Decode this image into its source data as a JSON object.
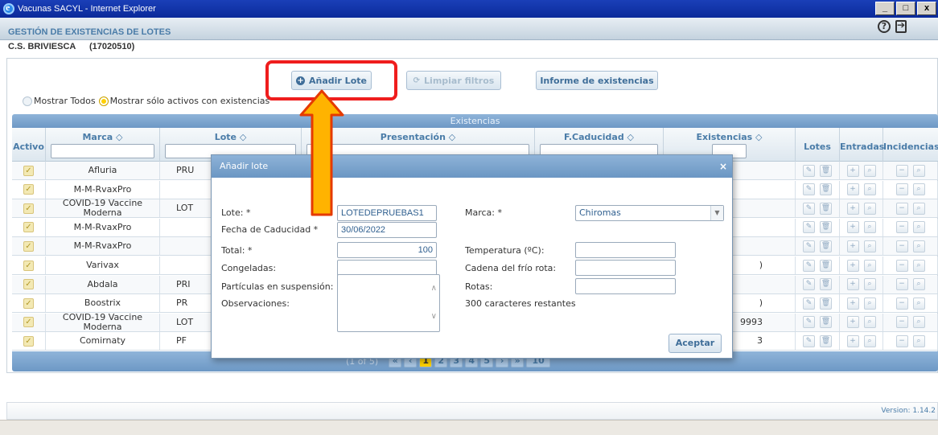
{
  "window": {
    "title": "Vacunas SACYL - Internet Explorer",
    "controls": {
      "minimize": "_",
      "maximize": "□",
      "close": "x"
    }
  },
  "app": {
    "title": "GESTIÓN DE EXISTENCIAS DE LOTES",
    "center_name": "C.S. BRIVIESCA",
    "center_code": "(17020510)",
    "help_glyph": "?"
  },
  "toolbar": {
    "add_lot": "Añadir Lote",
    "clear_filters": "Limpiar filtros",
    "stock_report": "Informe de existencias"
  },
  "filter_radios": {
    "show_all": "Mostrar Todos",
    "show_active": "Mostrar sólo activos con existencias",
    "selected": "show_active"
  },
  "grid": {
    "caption": "Existencias",
    "headers": {
      "activo": "Activo",
      "marca": "Marca ◇",
      "lote": "Lote ◇",
      "presentacion": "Presentación ◇",
      "caducidad": "F.Caducidad ◇",
      "existencias": "Existencias ◇",
      "lotes": "Lotes",
      "entradas": "Entradas",
      "incidencias": "Incidencias"
    },
    "rows": [
      {
        "marca": "Afluria",
        "lote": "PRU",
        "exist": ""
      },
      {
        "marca": "M-M-RvaxPro",
        "lote": "",
        "exist": ""
      },
      {
        "marca": "COVID-19 Vaccine Moderna",
        "lote": "LOT",
        "exist": ""
      },
      {
        "marca": "M-M-RvaxPro",
        "lote": "",
        "exist": ""
      },
      {
        "marca": "M-M-RvaxPro",
        "lote": "",
        "exist": ""
      },
      {
        "marca": "Varivax",
        "lote": "",
        "exist": ")"
      },
      {
        "marca": "Abdala",
        "lote": "PRI",
        "exist": ""
      },
      {
        "marca": "Boostrix",
        "lote": "PR",
        "exist": ")"
      },
      {
        "marca": "COVID-19 Vaccine Moderna",
        "lote": "LOT",
        "exist": "9993"
      },
      {
        "marca": "Comirnaty",
        "lote": "PF",
        "exist": "3"
      }
    ],
    "check_glyph": "✓",
    "row_icons": [
      "✎",
      "🗑",
      "+",
      "⌕",
      "−",
      "⌕"
    ],
    "pager": {
      "info": "(1 of 5)",
      "pages": [
        "1",
        "2",
        "3",
        "4",
        "5"
      ],
      "current": "1",
      "rows_per_page": "10"
    }
  },
  "status": {
    "version": "Version: 1.14.2"
  },
  "dialog": {
    "title": "Añadir lote",
    "close": "×",
    "fields": {
      "lote_label": "Lote: *",
      "lote_value": "LOTEDEPRUEBAS1",
      "marca_label": "Marca: *",
      "marca_value": "Chiromas",
      "caducidad_label": "Fecha de Caducidad *",
      "caducidad_value": "30/06/2022",
      "total_label": "Total: *",
      "total_value": "100",
      "temperatura_label": "Temperatura (ºC):",
      "congeladas_label": "Congeladas:",
      "cadena_label": "Cadena del frío rota:",
      "particulas_label": "Partículas en suspensión:",
      "rotas_label": "Rotas:",
      "observaciones_label": "Observaciones:",
      "chars_remaining": "300 caracteres restantes"
    },
    "accept": "Aceptar"
  },
  "colors": {
    "highlight": "#ef1d1d",
    "arrow_fill": "#ffb300",
    "header_blue": "#6d98c5",
    "title_blue": "#4a7ca8"
  }
}
